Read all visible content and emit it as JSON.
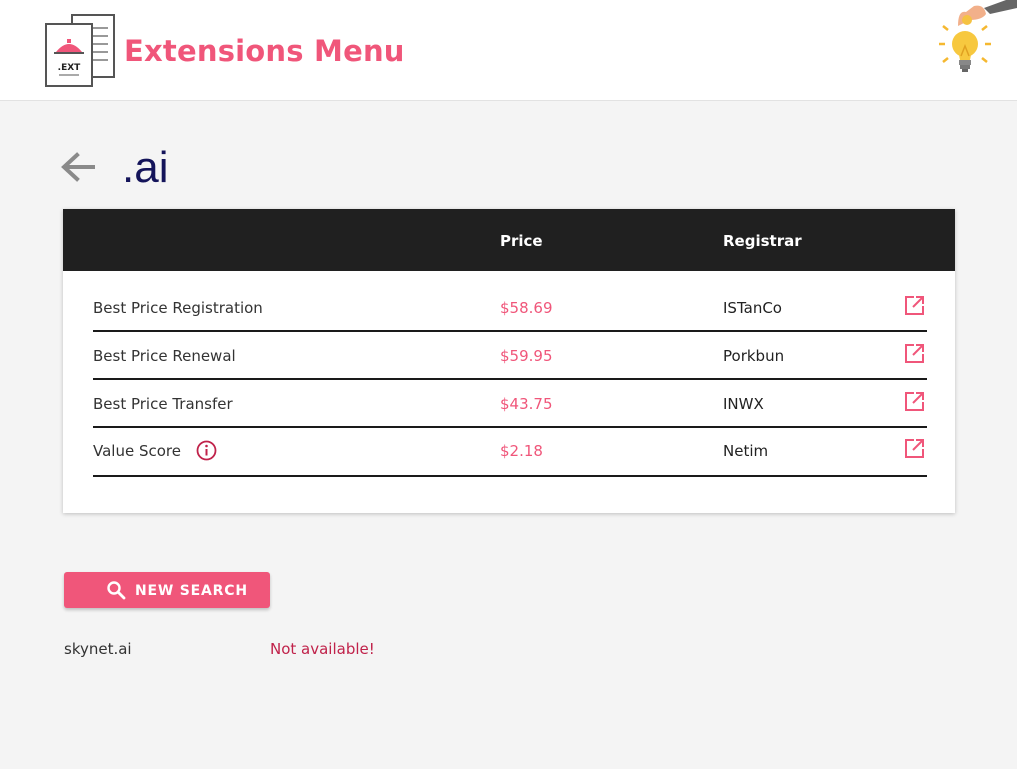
{
  "header": {
    "app_title": "Extensions Menu",
    "logo_label": ".EXT",
    "brand_color": "#f0567a"
  },
  "page": {
    "tld": ".ai"
  },
  "table": {
    "columns": [
      "",
      "Price",
      "Registrar"
    ],
    "rows": [
      {
        "label": "Best Price Registration",
        "price": "$58.69",
        "registrar": "ISTanCo",
        "link_icon": "external-link-icon"
      },
      {
        "label": "Best Price Renewal",
        "price": "$59.95",
        "registrar": "Porkbun",
        "link_icon": "external-link-icon"
      },
      {
        "label": "Best Price Transfer",
        "price": "$43.75",
        "registrar": "INWX",
        "link_icon": "external-link-icon"
      },
      {
        "label": "Value Score",
        "price": "$2.18",
        "registrar": "Netim",
        "link_icon": "external-link-icon",
        "info_icon": "info-icon"
      }
    ]
  },
  "actions": {
    "new_search_label": "NEW SEARCH",
    "new_search_icon": "search-icon"
  },
  "result": {
    "domain": "skynet.ai",
    "status": "Not available!"
  },
  "colors": {
    "accent": "#f0567a",
    "title_navy": "#14145a",
    "table_header": "#202020",
    "unavailable": "#c0224a"
  }
}
